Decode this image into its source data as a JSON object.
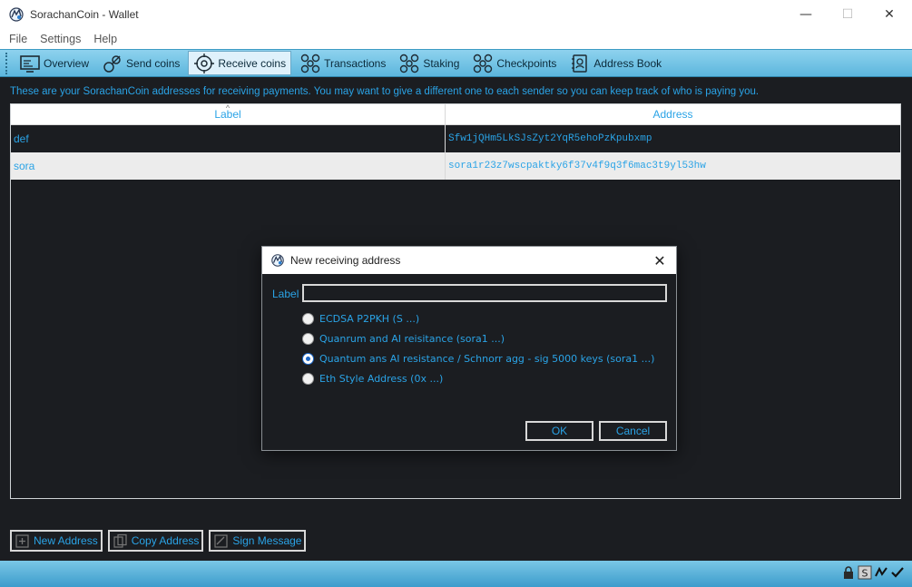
{
  "window": {
    "title": "SorachanCoin - Wallet",
    "minimize_glyph": "—",
    "maximize_glyph": "☐",
    "close_glyph": "✕"
  },
  "menu": [
    "File",
    "Settings",
    "Help"
  ],
  "toolbar": {
    "items": [
      {
        "label": "Overview",
        "icon": "overview-icon"
      },
      {
        "label": "Send coins",
        "icon": "send-coins-icon"
      },
      {
        "label": "Receive coins",
        "icon": "receive-coins-icon",
        "active": true
      },
      {
        "label": "Transactions",
        "icon": "transactions-icon"
      },
      {
        "label": "Staking",
        "icon": "staking-icon"
      },
      {
        "label": "Checkpoints",
        "icon": "checkpoints-icon"
      },
      {
        "label": "Address Book",
        "icon": "address-book-icon"
      }
    ]
  },
  "receive": {
    "info": "These are your SorachanCoin addresses for receiving payments. You may want to give a different one to each sender so you can keep track of who is paying you.",
    "columns": {
      "label": "Label",
      "address": "Address"
    },
    "rows": [
      {
        "label": "def",
        "address": "Sfw1jQHm5LkSJsZyt2YqR5ehoPzKpubxmp"
      },
      {
        "label": "sora",
        "address": "sora1r23z7wscpaktky6f37v4f9q3f6mac3t9yl53hw"
      }
    ],
    "buttons": {
      "new_address": "New Address",
      "copy_address": "Copy Address",
      "sign_message": "Sign Message"
    }
  },
  "dialog": {
    "title": "New receiving address",
    "close_glyph": "✕",
    "label_text": "Label",
    "label_value": "",
    "options": [
      {
        "text": "ECDSA P2PKH (S ...)",
        "checked": false
      },
      {
        "text": "Quanrum and AI reisitance (sora1 ...)",
        "checked": false
      },
      {
        "text": "Quantum ans AI resistance / Schnorr agg - sig 5000 keys (sora1 ...)",
        "checked": true
      },
      {
        "text": "Eth Style Address (0x ...)",
        "checked": false
      }
    ],
    "ok": "OK",
    "cancel": "Cancel"
  },
  "colors": {
    "accent_text": "#2aa3e6",
    "background": "#1b1d21",
    "toolbar": "#6cc0e4"
  }
}
